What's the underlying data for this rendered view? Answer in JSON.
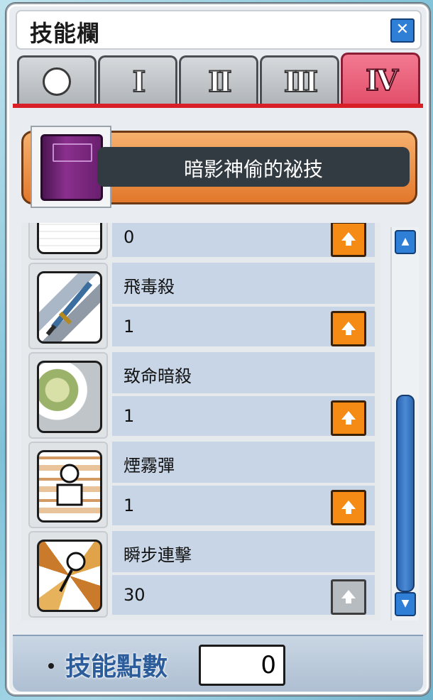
{
  "window": {
    "title": "技能欄",
    "close_icon": "close-icon"
  },
  "tabs": [
    {
      "label": "○",
      "icon": "circle-icon",
      "active": false
    },
    {
      "label": "I",
      "active": false
    },
    {
      "label": "II",
      "active": false
    },
    {
      "label": "III",
      "active": false
    },
    {
      "label": "IV",
      "active": true
    }
  ],
  "job": {
    "name": "暗影神偷的祕技",
    "icon": "skill-book-icon"
  },
  "skills": [
    {
      "name": "",
      "level": "0",
      "icon": "skill-icon-partial",
      "can_upgrade": true
    },
    {
      "name": "飛毒殺",
      "level": "1",
      "icon": "dagger-skill-icon",
      "can_upgrade": true
    },
    {
      "name": "致命暗殺",
      "level": "1",
      "icon": "assassinate-skill-icon",
      "can_upgrade": true
    },
    {
      "name": "煙霧彈",
      "level": "1",
      "icon": "smoke-bomb-skill-icon",
      "can_upgrade": true
    },
    {
      "name": "瞬步連擊",
      "level": "30",
      "icon": "flash-step-skill-icon",
      "can_upgrade": false
    }
  ],
  "footer": {
    "label": "技能點數",
    "value": "0"
  },
  "colors": {
    "active_tab": "#e24d69",
    "upgrade_button": "#f58b14",
    "accent_blue": "#2f7fd6"
  }
}
